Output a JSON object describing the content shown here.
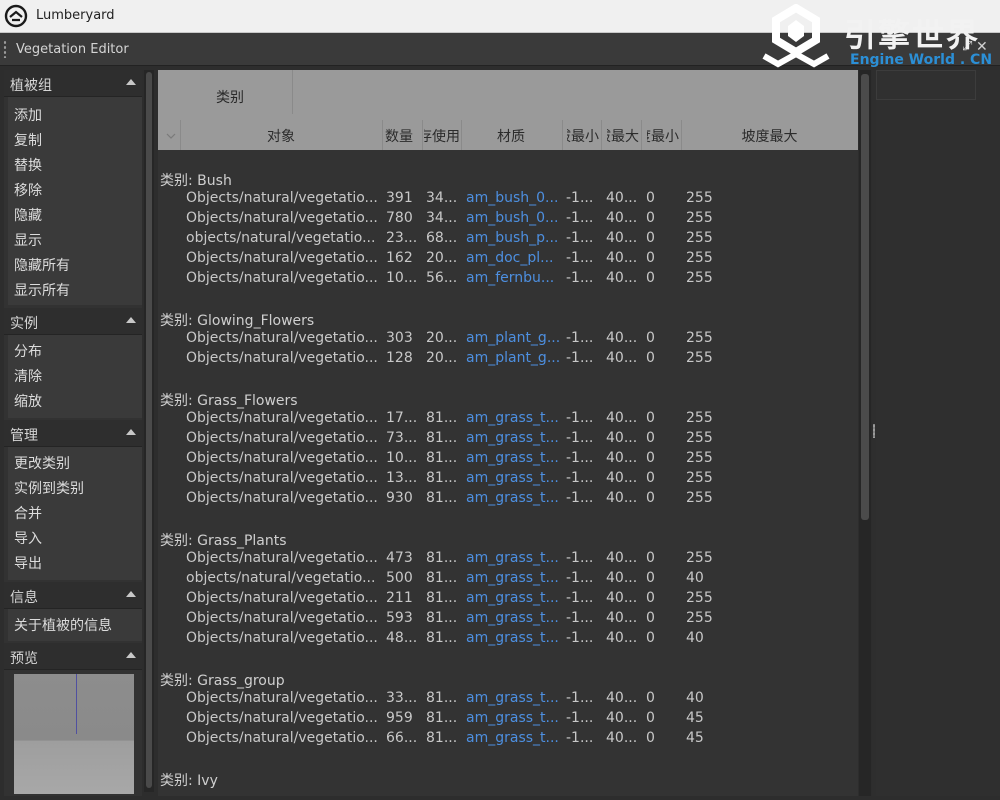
{
  "window": {
    "title": "Lumberyard"
  },
  "editor": {
    "title": "Vegetation Editor",
    "float_glyph": "⤢",
    "close_glyph": "✕"
  },
  "watermark": {
    "cn": "引擎世界",
    "en": "Engine World . CN"
  },
  "left_panel": {
    "sections": [
      {
        "title": "植被组",
        "items": [
          "添加",
          "复制",
          "替换",
          "移除",
          "隐藏",
          "显示",
          "隐藏所有",
          "显示所有"
        ]
      },
      {
        "title": "实例",
        "items": [
          "分布",
          "清除",
          "缩放"
        ]
      },
      {
        "title": "管理",
        "items": [
          "更改类别",
          "实例到类别",
          "合并",
          "导入",
          "导出"
        ]
      },
      {
        "title": "信息",
        "items": [
          "关于植被的信息"
        ]
      },
      {
        "title": "预览",
        "items": []
      }
    ]
  },
  "table": {
    "category_header": "类别",
    "columns": [
      "对象",
      "数量",
      "内存使用",
      "材质",
      "拔最小",
      "拔最大",
      "度最小",
      "坡度最大"
    ],
    "groups": [
      {
        "label": "类别: Bush",
        "rows": [
          [
            "Objects/natural/vegetatio...",
            "391",
            "34...",
            "am_bush_0...",
            "-1...",
            "40...",
            "0",
            "255"
          ],
          [
            "Objects/natural/vegetatio...",
            "780",
            "34...",
            "am_bush_0...",
            "-1...",
            "40...",
            "0",
            "255"
          ],
          [
            "objects/natural/vegetatio...",
            "23...",
            "68...",
            "am_bush_p...",
            "-1...",
            "40...",
            "0",
            "255"
          ],
          [
            "Objects/natural/vegetatio...",
            "162",
            "20...",
            "am_doc_pl...",
            "-1...",
            "40...",
            "0",
            "255"
          ],
          [
            "Objects/natural/vegetatio...",
            "10...",
            "56...",
            "am_fernbu...",
            "-1...",
            "40...",
            "0",
            "255"
          ]
        ]
      },
      {
        "label": "类别: Glowing_Flowers",
        "rows": [
          [
            "Objects/natural/vegetatio...",
            "303",
            "20...",
            "am_plant_g...",
            "-1...",
            "40...",
            "0",
            "255"
          ],
          [
            "Objects/natural/vegetatio...",
            "128",
            "20...",
            "am_plant_g...",
            "-1...",
            "40...",
            "0",
            "255"
          ]
        ]
      },
      {
        "label": "类别: Grass_Flowers",
        "rows": [
          [
            "Objects/natural/vegetatio...",
            "17...",
            "81...",
            "am_grass_t...",
            "-1...",
            "40...",
            "0",
            "255"
          ],
          [
            "Objects/natural/vegetatio...",
            "73...",
            "81...",
            "am_grass_t...",
            "-1...",
            "40...",
            "0",
            "255"
          ],
          [
            "Objects/natural/vegetatio...",
            "10...",
            "81...",
            "am_grass_t...",
            "-1...",
            "40...",
            "0",
            "255"
          ],
          [
            "Objects/natural/vegetatio...",
            "13...",
            "81...",
            "am_grass_t...",
            "-1...",
            "40...",
            "0",
            "255"
          ],
          [
            "Objects/natural/vegetatio...",
            "930",
            "81...",
            "am_grass_t...",
            "-1...",
            "40...",
            "0",
            "255"
          ]
        ]
      },
      {
        "label": "类别: Grass_Plants",
        "rows": [
          [
            "Objects/natural/vegetatio...",
            "473",
            "81...",
            "am_grass_t...",
            "-1...",
            "40...",
            "0",
            "255"
          ],
          [
            "objects/natural/vegetatio...",
            "500",
            "81...",
            "am_grass_t...",
            "-1...",
            "40...",
            "0",
            "40"
          ],
          [
            "Objects/natural/vegetatio...",
            "211",
            "81...",
            "am_grass_t...",
            "-1...",
            "40...",
            "0",
            "255"
          ],
          [
            "Objects/natural/vegetatio...",
            "593",
            "81...",
            "am_grass_t...",
            "-1...",
            "40...",
            "0",
            "255"
          ],
          [
            "Objects/natural/vegetatio...",
            "48...",
            "81...",
            "am_grass_t...",
            "-1...",
            "40...",
            "0",
            "40"
          ]
        ]
      },
      {
        "label": "类别: Grass_group",
        "rows": [
          [
            "Objects/natural/vegetatio...",
            "33...",
            "81...",
            "am_grass_t...",
            "-1...",
            "40...",
            "0",
            "40"
          ],
          [
            "Objects/natural/vegetatio...",
            "959",
            "81...",
            "am_grass_t...",
            "-1...",
            "40...",
            "0",
            "45"
          ],
          [
            "Objects/natural/vegetatio...",
            "66...",
            "81...",
            "am_grass_t...",
            "-1...",
            "40...",
            "0",
            "45"
          ]
        ]
      },
      {
        "label": "类别: Ivy",
        "rows": []
      }
    ]
  },
  "colors": {
    "material_link": "#4d8fe0",
    "header_bg": "#9a9a9a",
    "panel_bg": "#333333"
  },
  "icons": [
    "lumberyard-logo-icon",
    "grip-icon",
    "float-icon",
    "close-icon",
    "collapse-arrow-icon",
    "sort-arrow-icon"
  ]
}
